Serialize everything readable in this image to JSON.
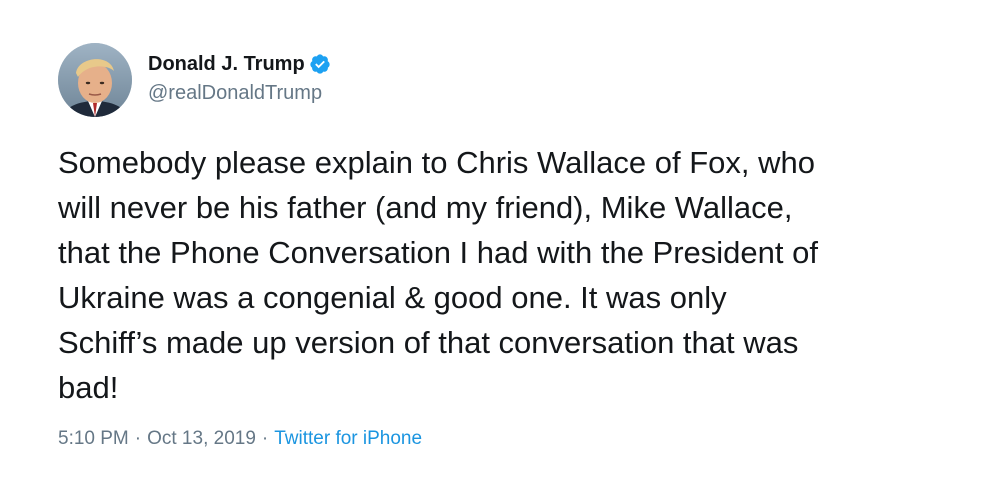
{
  "author": {
    "name": "Donald J. Trump",
    "handle": "@realDonaldTrump",
    "verified": true,
    "verified_color": "#1da1f2"
  },
  "tweet": {
    "lines": [
      "Somebody please explain to Chris Wallace of Fox, who",
      "will never be his father (and my friend), Mike Wallace,",
      "that the Phone Conversation I had with the President of",
      "Ukraine was a congenial & good one. It was only",
      "Schiff’s made up version of that conversation that was",
      "bad!"
    ]
  },
  "meta": {
    "time": "5:10 PM",
    "separator": "·",
    "date": "Oct 13, 2019",
    "source": "Twitter for iPhone",
    "source_color": "#1b95e0"
  },
  "colors": {
    "text": "#14171a",
    "secondary": "#657786",
    "background": "#ffffff"
  }
}
